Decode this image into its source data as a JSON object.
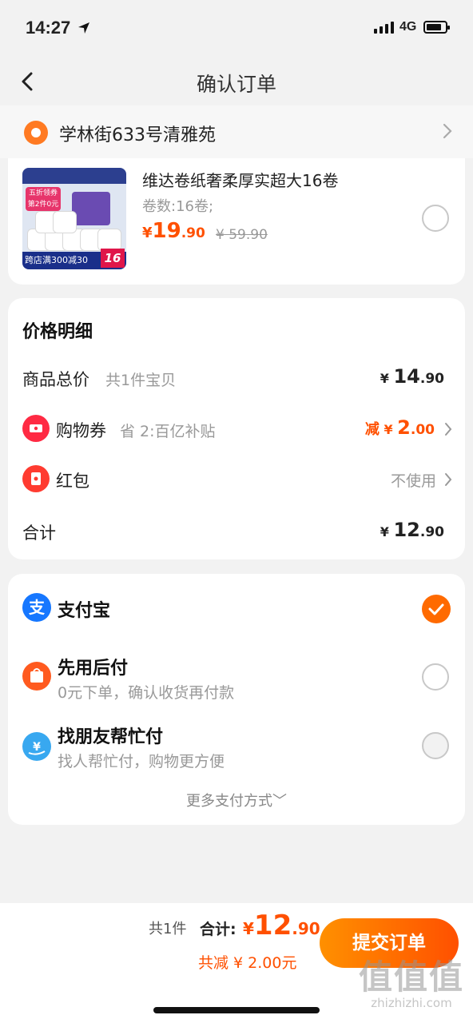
{
  "status_bar": {
    "time": "14:27",
    "network": "4G"
  },
  "nav": {
    "title": "确认订单"
  },
  "address": {
    "text": "学林街633号清雅苑"
  },
  "product": {
    "title": "维达卷纸奢柔厚实超大16卷",
    "spec": "卷数:16卷;",
    "price_currency": "¥",
    "price_int": "19",
    "price_dec": ".90",
    "original_price": "¥ 59.90",
    "thumb_badge": "五折领券 第2件0元",
    "thumb_strip": "跨店满300减30",
    "thumb_num": "16"
  },
  "price_detail": {
    "heading": "价格明细",
    "goods_total": {
      "label": "商品总价",
      "sub": "共1件宝贝",
      "currency": "¥",
      "int": "14",
      "dec": ".90"
    },
    "coupon": {
      "label": "购物券",
      "sub": "省 2:百亿补贴",
      "prefix": "减",
      "currency": "¥",
      "int": "2",
      "dec": ".00"
    },
    "red_packet": {
      "label": "红包",
      "value": "不使用"
    },
    "total": {
      "label": "合计",
      "currency": "¥",
      "int": "12",
      "dec": ".90"
    }
  },
  "payment": {
    "options": [
      {
        "name": "支付宝",
        "sub": "",
        "icon": "alipay-icon",
        "selected": true
      },
      {
        "name": "先用后付",
        "sub": "0元下单，确认收货再付款",
        "icon": "pay-later-icon",
        "selected": false
      },
      {
        "name": "找朋友帮忙付",
        "sub": "找人帮忙付，购物更方便",
        "icon": "friend-pay-icon",
        "selected": false
      }
    ],
    "more": "更多支付方式﹀"
  },
  "bottom_bar": {
    "count": "共1件",
    "total_label": "合计:",
    "currency": "¥",
    "total_int": "12",
    "total_dec": ".90",
    "saved": "共减 ¥ 2.00元",
    "submit": "提交订单"
  },
  "watermark": {
    "big": "值值值",
    "small": "zhizhizhi.com"
  },
  "colors": {
    "accent": "#ff5000",
    "alipay": "#1677ff",
    "pay_later": "#ff5a1f",
    "friend_pay": "#38a8f0",
    "coupon": "#ff2a43"
  }
}
